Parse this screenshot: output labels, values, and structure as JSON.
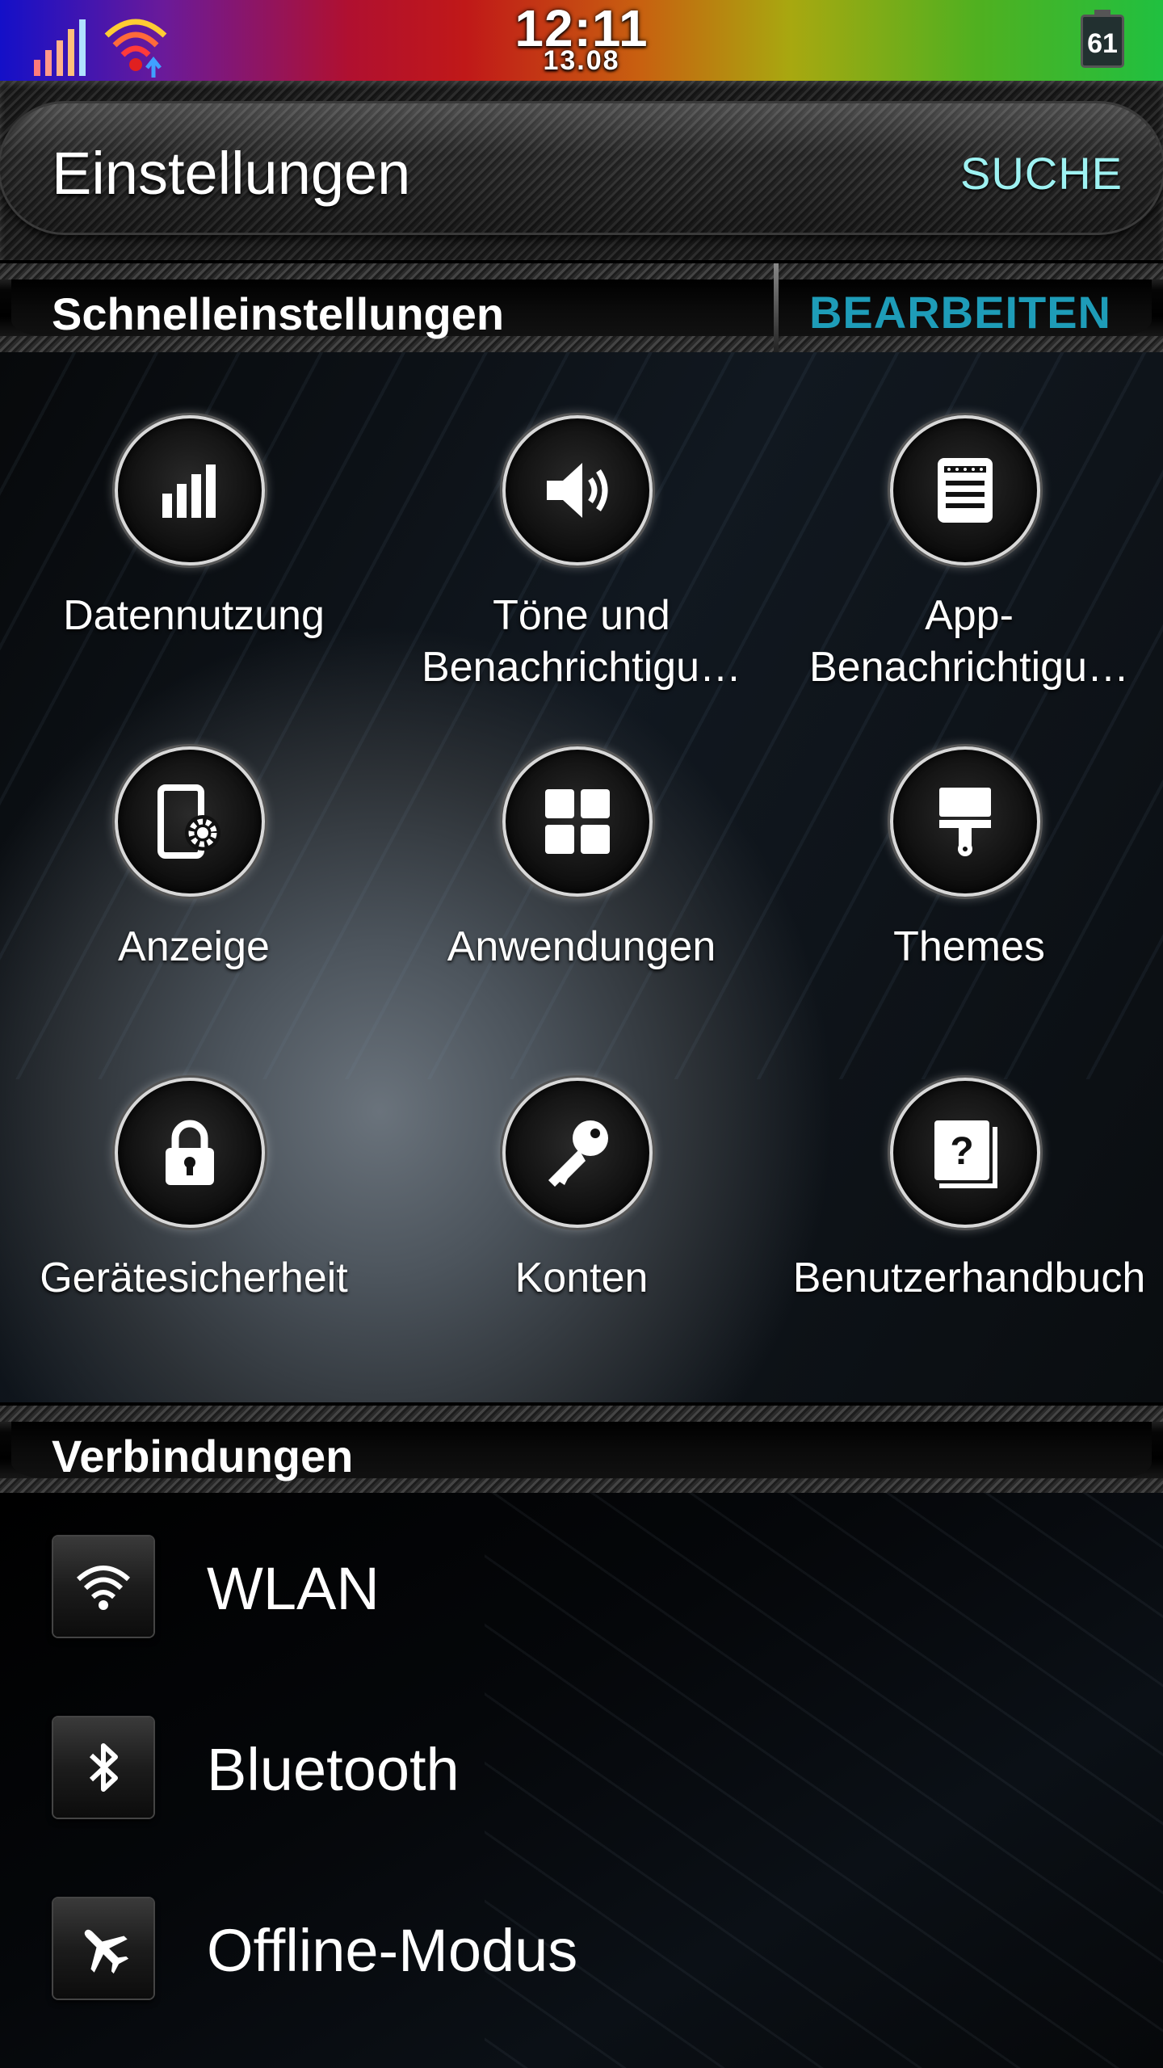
{
  "status_bar": {
    "time": "12:11",
    "date": "13.08",
    "battery_level": "61",
    "icons": [
      "signal-icon",
      "wifi-icon",
      "battery-icon"
    ]
  },
  "app_bar": {
    "title": "Einstellungen",
    "search_label": "SUCHE"
  },
  "quick_settings": {
    "header": "Schnelleinstellungen",
    "edit_label": "BEARBEITEN",
    "tiles": [
      {
        "label": "Datennutzung",
        "icon": "data-usage-icon"
      },
      {
        "label": "Töne und Benachrichtigu…",
        "icon": "speaker-icon"
      },
      {
        "label": "App-Benachrichtigu…",
        "icon": "notifications-icon"
      },
      {
        "label": "Anzeige",
        "icon": "display-icon"
      },
      {
        "label": "Anwendungen",
        "icon": "apps-icon"
      },
      {
        "label": "Themes",
        "icon": "paint-brush-icon"
      },
      {
        "label": "Gerätesicherheit",
        "icon": "lock-icon"
      },
      {
        "label": "Konten",
        "icon": "key-icon"
      },
      {
        "label": "Benutzerhandbuch",
        "icon": "manual-icon"
      }
    ]
  },
  "connections": {
    "header": "Verbindungen",
    "items": [
      {
        "label": "WLAN",
        "icon": "wifi-icon"
      },
      {
        "label": "Bluetooth",
        "icon": "bluetooth-icon"
      },
      {
        "label": "Offline-Modus",
        "icon": "airplane-icon"
      }
    ]
  },
  "colors": {
    "search_accent": "#9ef2f2",
    "edit_accent": "#1e9cb8"
  }
}
